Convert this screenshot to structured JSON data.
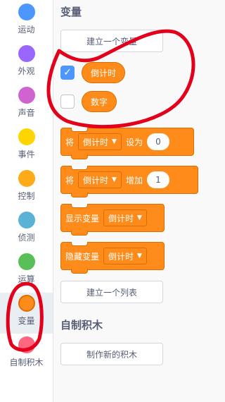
{
  "categories": [
    {
      "label": "运动",
      "color": "#4c97ff"
    },
    {
      "label": "外观",
      "color": "#9966ff"
    },
    {
      "label": "声音",
      "color": "#cf63cf"
    },
    {
      "label": "事件",
      "color": "#ffd500"
    },
    {
      "label": "控制",
      "color": "#ffab19"
    },
    {
      "label": "侦测",
      "color": "#5cb1d6"
    },
    {
      "label": "运算",
      "color": "#59c059"
    },
    {
      "label": "变量",
      "color": "#ff8c1a"
    },
    {
      "label": "自制积木",
      "color": "#ff6680"
    }
  ],
  "variables_section": {
    "title": "变量",
    "make_variable_button": "建立一个变量",
    "variables": [
      {
        "name": "倒计时",
        "checked": true
      },
      {
        "name": "数字",
        "checked": false
      }
    ],
    "blocks": {
      "set": {
        "prefix": "将",
        "variable": "倒计时",
        "verb": "设为",
        "value": "0"
      },
      "change": {
        "prefix": "将",
        "variable": "倒计时",
        "verb": "增加",
        "value": "1"
      },
      "show": {
        "label": "显示变量",
        "variable": "倒计时"
      },
      "hide": {
        "label": "隐藏变量",
        "variable": "倒计时"
      }
    },
    "make_list_button": "建立一个列表"
  },
  "my_blocks_section": {
    "title": "自制积木",
    "make_block_button": "制作新的积木"
  },
  "annotation_color": "#e3001b"
}
